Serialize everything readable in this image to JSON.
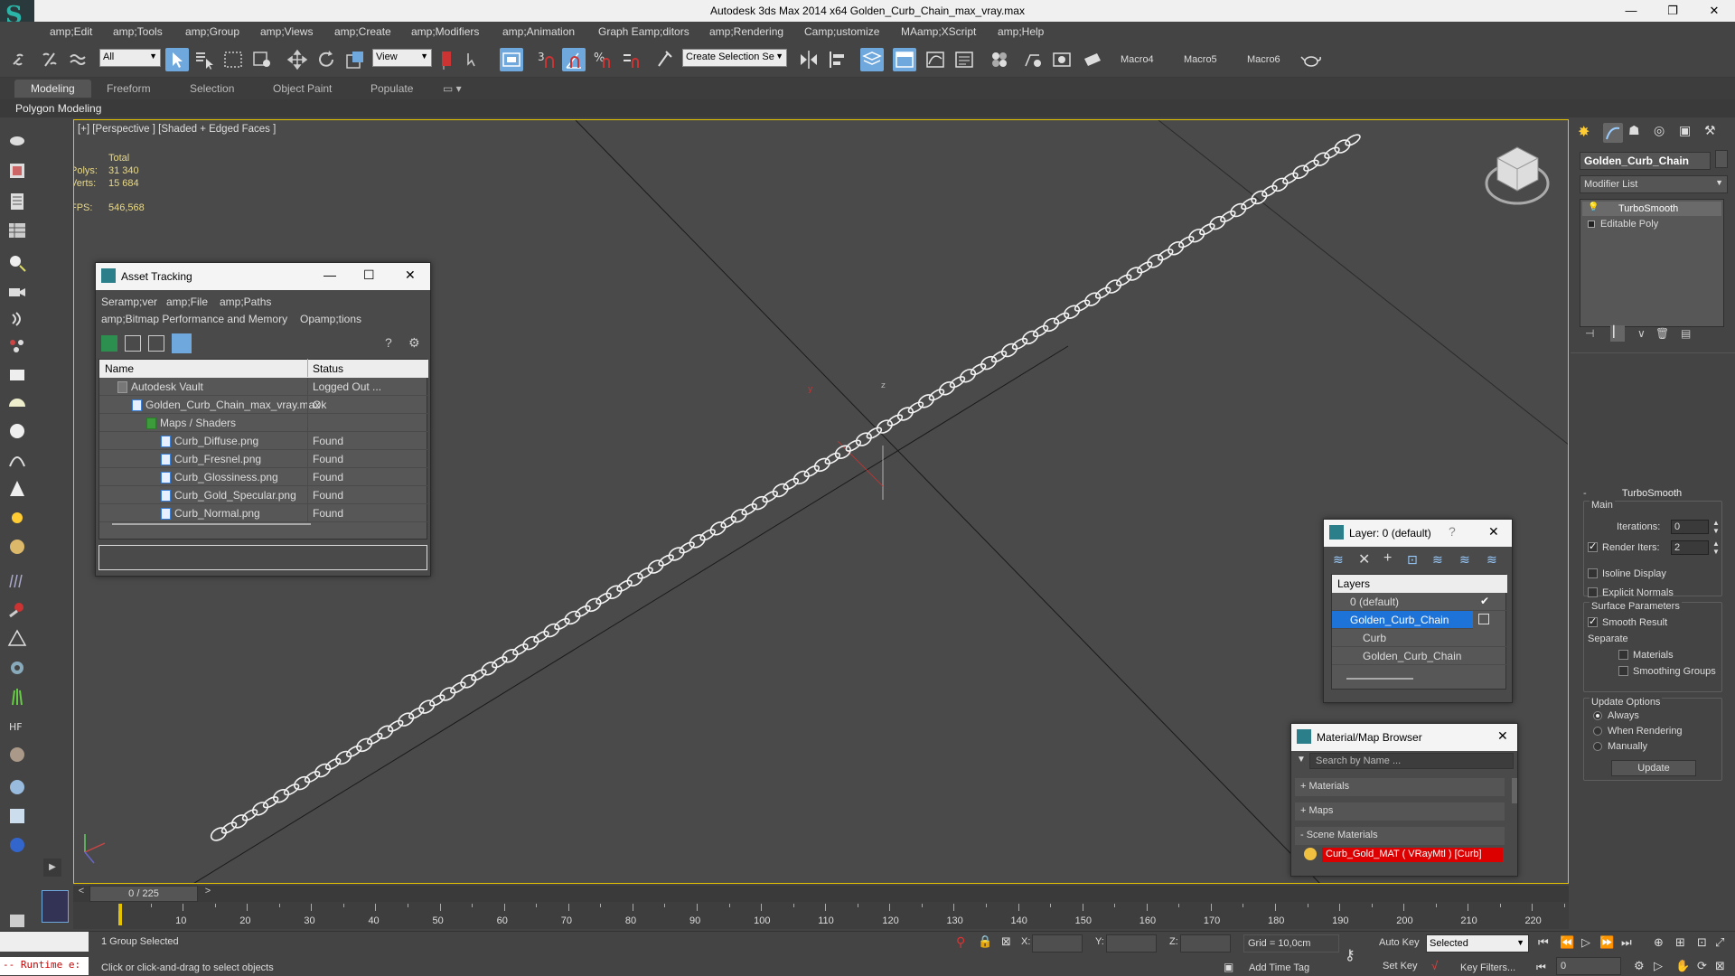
{
  "window": {
    "title": "Autodesk 3ds Max  2014 x64     Golden_Curb_Chain_max_vray.max",
    "min": "—",
    "max": "❐",
    "close": "✕"
  },
  "menu": [
    "amp;Edit",
    "amp;Tools",
    "amp;Group",
    "amp;Views",
    "amp;Create",
    "amp;Modifiers",
    "amp;Animation",
    "Graph Eamp;ditors",
    "amp;Rendering",
    "Camp;ustomize",
    "MAamp;XScript",
    "amp;Help"
  ],
  "toolbar": {
    "filter": "All",
    "refcoord": "View",
    "selection_set": "Create Selection Se",
    "macros": [
      "Macro4",
      "Macro5",
      "Macro6"
    ]
  },
  "ribbon": {
    "tabs": [
      "Modeling",
      "Freeform",
      "Selection",
      "Object Paint",
      "Populate"
    ],
    "sub": "Polygon Modeling"
  },
  "viewport": {
    "label": "[+] [Perspective ] [Shaded + Edged Faces ]",
    "total": "Total",
    "polys_label": "Polys:",
    "polys": "31 340",
    "verts_label": "Verts:",
    "verts": "15 684",
    "fps_label": "FPS:",
    "fps": "546,568",
    "axis_y": "y",
    "axis_z": "z"
  },
  "asset_tracking": {
    "title": "Asset Tracking",
    "menu1": [
      "Seramp;ver",
      "amp;File",
      "amp;Paths"
    ],
    "menu2": [
      "amp;Bitmap Performance and Memory",
      "Opamp;tions"
    ],
    "col_name": "Name",
    "col_status": "Status",
    "rows": [
      {
        "name": "Autodesk Vault",
        "status": "Logged Out ..."
      },
      {
        "name": "Golden_Curb_Chain_max_vray.max",
        "status": "Ok"
      },
      {
        "name": "Maps / Shaders",
        "status": ""
      },
      {
        "name": "Curb_Diffuse.png",
        "status": "Found"
      },
      {
        "name": "Curb_Fresnel.png",
        "status": "Found"
      },
      {
        "name": "Curb_Glossiness.png",
        "status": "Found"
      },
      {
        "name": "Curb_Gold_Specular.png",
        "status": "Found"
      },
      {
        "name": "Curb_Normal.png",
        "status": "Found"
      }
    ]
  },
  "layer_window": {
    "title": "Layer: 0 (default)",
    "help": "?",
    "header": "Layers",
    "items": [
      "0 (default)",
      "Golden_Curb_Chain",
      "Curb",
      "Golden_Curb_Chain"
    ]
  },
  "material_browser": {
    "title": "Material/Map Browser",
    "search_placeholder": "Search by Name ...",
    "sections": [
      "+ Materials",
      "+ Maps",
      "- Scene Materials"
    ],
    "material": "Curb_Gold_MAT ( VRayMtl ) [Curb]"
  },
  "command_panel": {
    "object_name": "Golden_Curb_Chain",
    "modifier_list": "Modifier List",
    "stack": [
      "TurboSmooth",
      "Editable Poly"
    ],
    "rollout": "TurboSmooth",
    "main": "Main",
    "iterations_label": "Iterations:",
    "iterations": "0",
    "render_iters_label": "Render Iters:",
    "render_iters": "2",
    "isoline": "Isoline Display",
    "explicit": "Explicit Normals",
    "surface": "Surface Parameters",
    "smooth_result": "Smooth Result",
    "separate": "Separate",
    "materials": "Materials",
    "smoothing_groups": "Smoothing Groups",
    "update_options": "Update Options",
    "always": "Always",
    "when_rendering": "When Rendering",
    "manually": "Manually",
    "update": "Update"
  },
  "timeline": {
    "frame": "0 / 225",
    "ticks": [
      "10",
      "20",
      "30",
      "40",
      "50",
      "60",
      "70",
      "80",
      "90",
      "100",
      "110",
      "120",
      "130",
      "140",
      "150",
      "160",
      "170",
      "180",
      "190",
      "200",
      "210",
      "220"
    ]
  },
  "status": {
    "script": "-- Runtime e:",
    "selection": "1 Group Selected",
    "prompt": "Click or click-and-drag to select objects",
    "x": "X:",
    "y": "Y:",
    "z": "Z:",
    "grid": "Grid = 10,0cm",
    "add_time_tag": "Add Time Tag",
    "auto_key": "Auto Key",
    "set_key": "Set Key",
    "selected": "Selected",
    "key_filters": "Key Filters...",
    "frame_value": "0"
  }
}
